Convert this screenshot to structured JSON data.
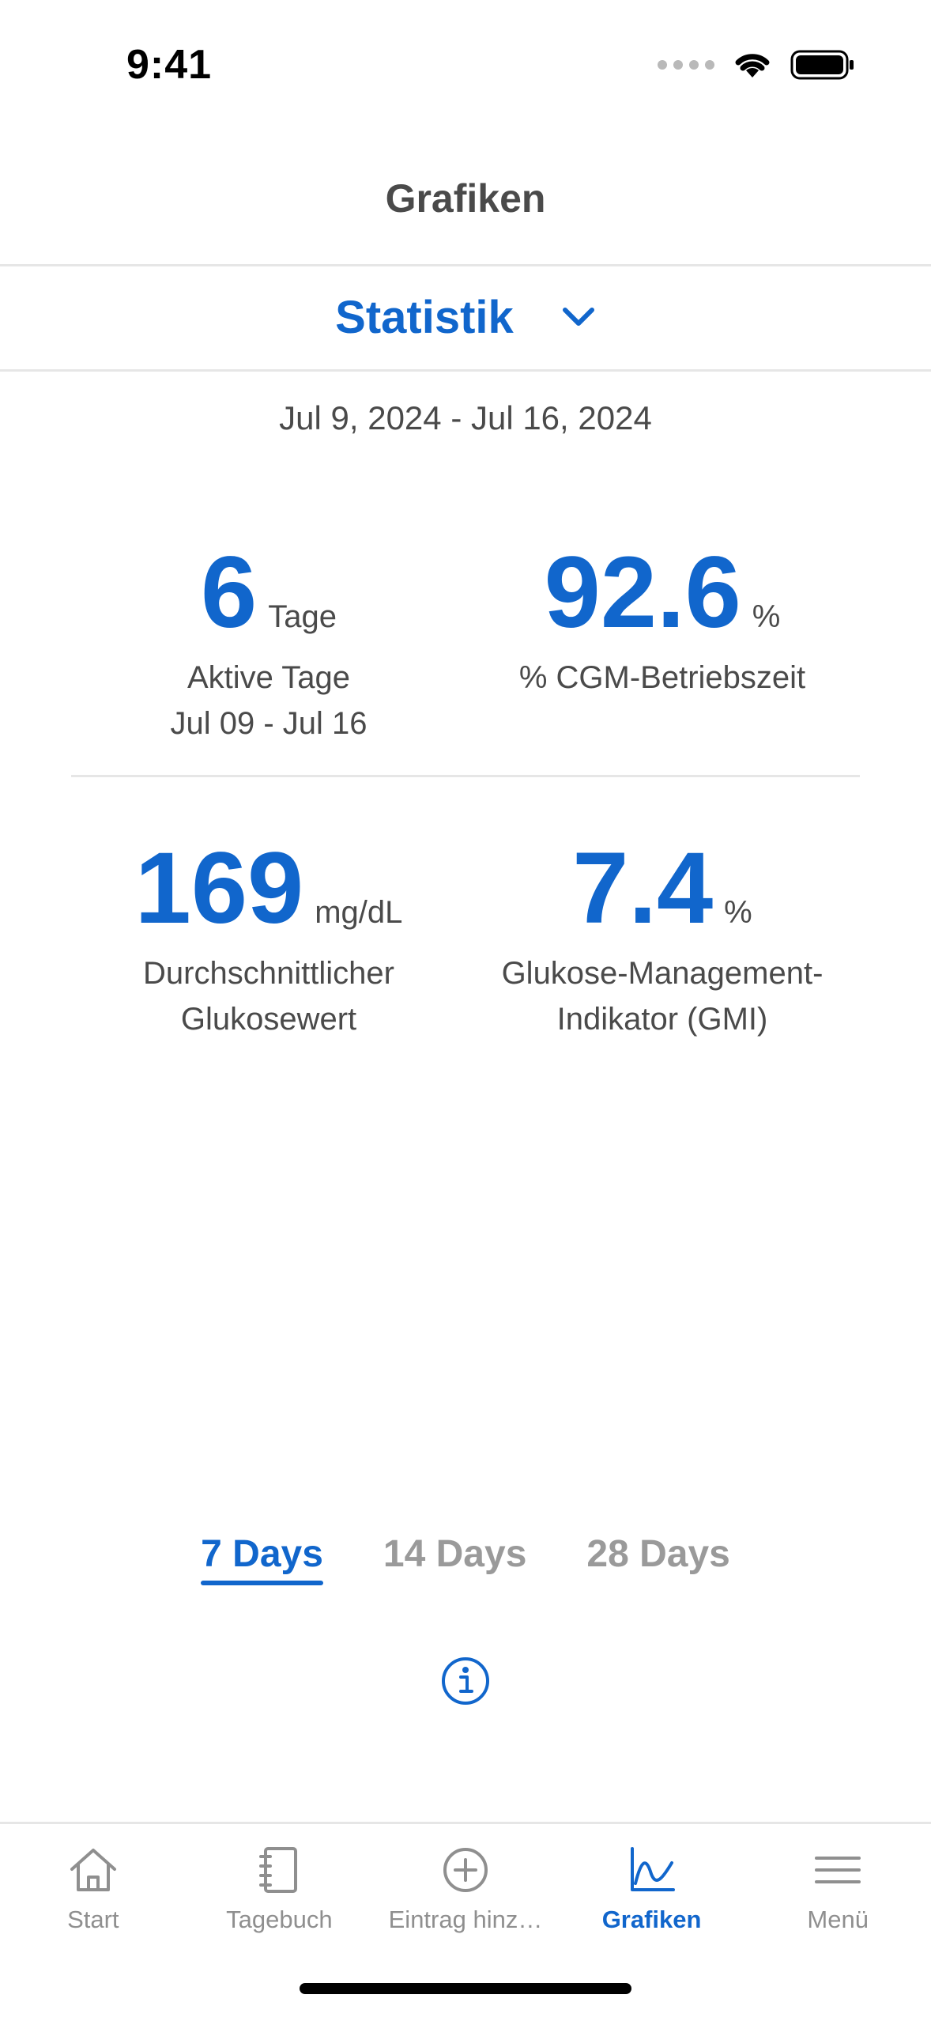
{
  "status_bar": {
    "time": "9:41"
  },
  "header": {
    "title": "Grafiken"
  },
  "selector": {
    "label": "Statistik"
  },
  "date_range": "Jul 9, 2024 - Jul 16, 2024",
  "stats": {
    "active_days": {
      "value": "6",
      "unit": "Tage",
      "label": "Aktive Tage",
      "sublabel": "Jul 09 - Jul 16"
    },
    "cgm_uptime": {
      "value": "92.6",
      "unit": "%",
      "label": "% CGM-Betriebszeit"
    },
    "avg_glucose": {
      "value": "169",
      "unit": "mg/dL",
      "label_line1": "Durchschnittlicher",
      "label_line2": "Glukosewert"
    },
    "gmi": {
      "value": "7.4",
      "unit": "%",
      "label_line1": "Glukose-Management-",
      "label_line2": "Indikator (GMI)"
    }
  },
  "period_tabs": [
    {
      "label": "7 Days",
      "active": true
    },
    {
      "label": "14 Days",
      "active": false
    },
    {
      "label": "28 Days",
      "active": false
    }
  ],
  "tab_bar": {
    "items": [
      {
        "label": "Start",
        "icon": "home-icon"
      },
      {
        "label": "Tagebuch",
        "icon": "notebook-icon"
      },
      {
        "label": "Eintrag hinz…",
        "icon": "add-circle-icon"
      },
      {
        "label": "Grafiken",
        "icon": "chart-icon",
        "active": true
      },
      {
        "label": "Menü",
        "icon": "menu-icon"
      }
    ]
  },
  "colors": {
    "accent": "#1166cc",
    "text": "#4a4a4a",
    "inactive": "#9a9a9a"
  }
}
